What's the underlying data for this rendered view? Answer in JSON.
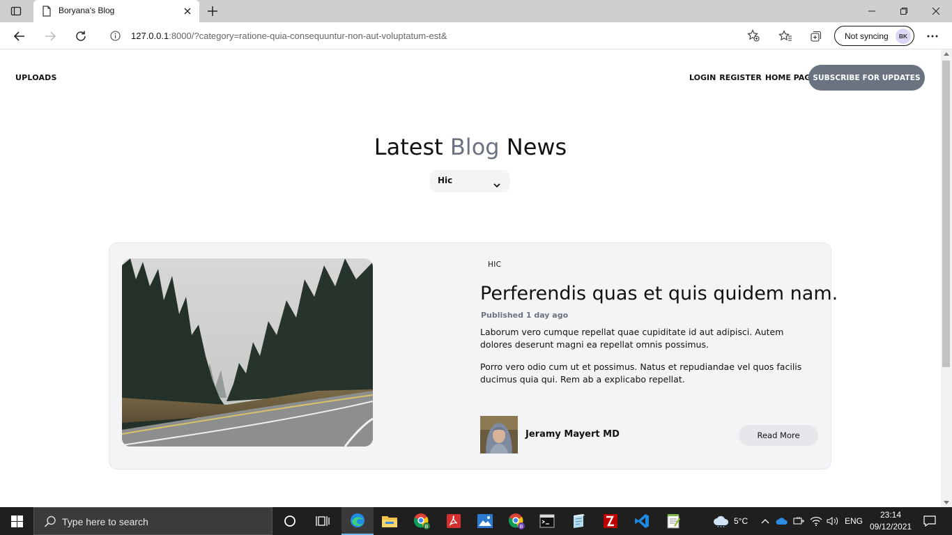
{
  "browser": {
    "tab_title": "Boryana's Blog",
    "url_host": "127.0.0.1",
    "url_rest": ":8000/?category=ratione-quia-consequuntur-non-aut-voluptatum-est&",
    "sync_label": "Not syncing",
    "profile_initials": "BK",
    "icons": [
      "tab-actions-icon",
      "document-icon",
      "close-icon",
      "plus-icon",
      "minimize-icon",
      "restore-icon",
      "close-window-icon",
      "back-icon",
      "forward-icon",
      "refresh-icon",
      "info-icon",
      "add-favorite-icon",
      "favorites-icon",
      "collections-icon",
      "more-icon"
    ]
  },
  "site": {
    "nav_uploads": "UPLOADS",
    "nav_login": "LOGIN",
    "nav_register": "REGISTER",
    "nav_home": "HOME PAGE",
    "subscribe_label": "SUBSCRIBE FOR UPDATES",
    "headline_pre": "Latest ",
    "headline_accent": "Blog",
    "headline_post": " News",
    "category_selected": "Hic",
    "accent_color": "#6b7280"
  },
  "post": {
    "category": "HIC",
    "title": "Perferendis quas et quis quidem nam.",
    "published_prefix": "Published ",
    "published_when": "1 day ago",
    "paragraph_1": "Laborum vero cumque repellat quae cupiditate id aut adipisci. Autem dolores deserunt magni ea repellat omnis possimus.",
    "paragraph_2": "Porro vero odio cum ut et possimus. Natus et repudiandae vel quos facilis ducimus quia qui. Rem ab a explicabo repellat.",
    "author": "Jeramy Mayert MD",
    "read_more": "Read More"
  },
  "taskbar": {
    "search_placeholder": "Type here to search",
    "temperature": "5°C",
    "language": "ENG",
    "time": "23:14",
    "date": "09/12/2021"
  }
}
